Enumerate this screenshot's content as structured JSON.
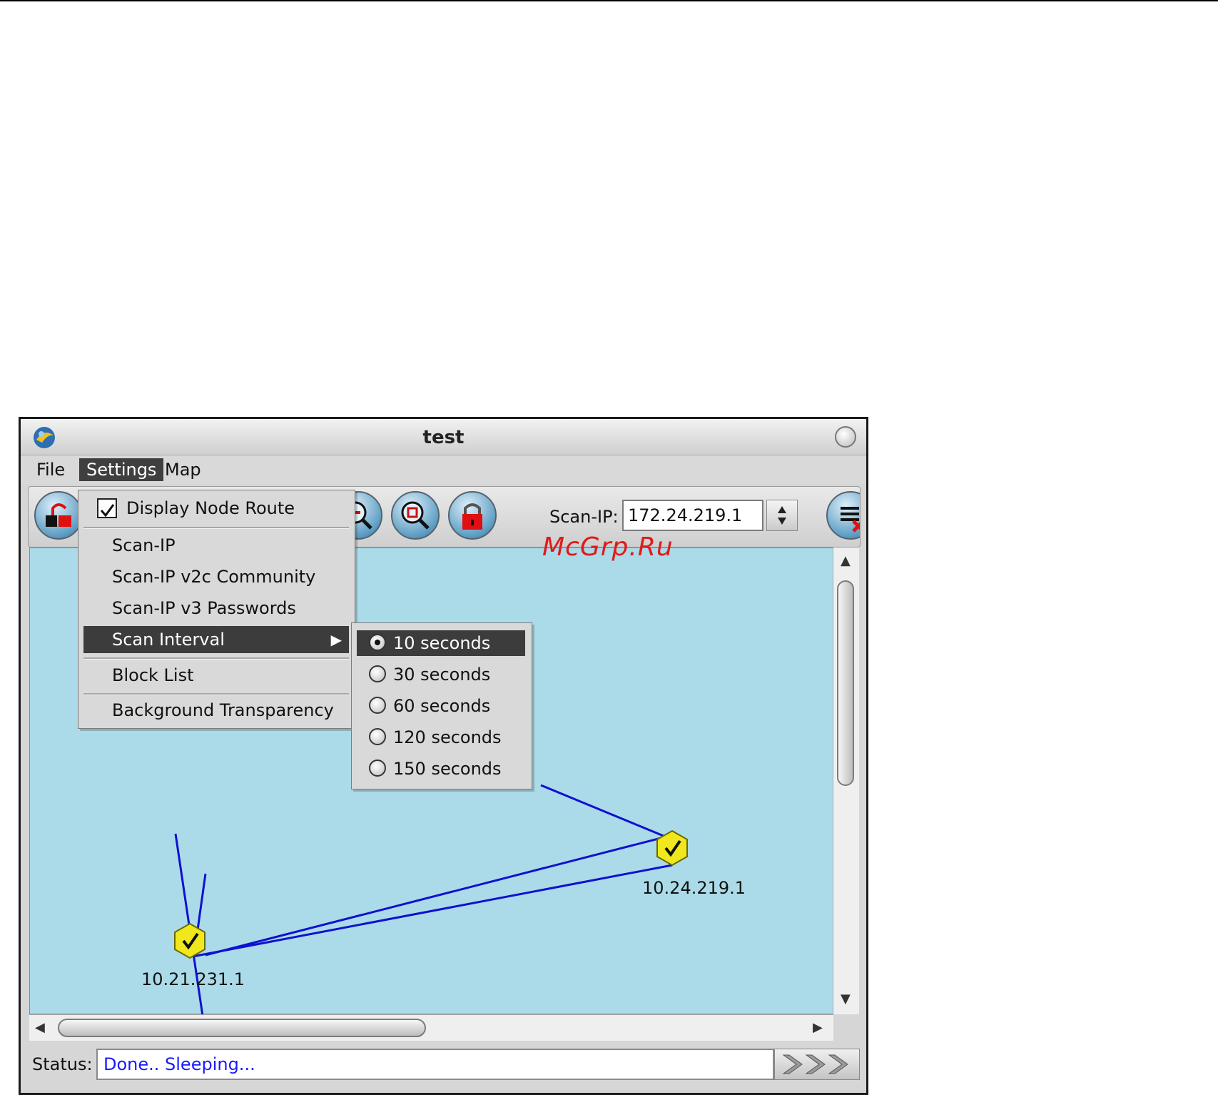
{
  "window": {
    "title": "test"
  },
  "menubar": {
    "file": "File",
    "settings": "Settings",
    "map": "Map"
  },
  "toolbar": {
    "buttons": [
      "unlock-icon",
      "zoom-out-icon",
      "zoom-fit-icon",
      "lock-icon",
      "list-delete-icon"
    ],
    "scan_ip_label": "Scan-IP:",
    "scan_ip_value": "172.24.219.1"
  },
  "settings_menu": {
    "display_node_route": "Display Node Route",
    "display_node_route_checked": true,
    "scan_ip": "Scan-IP",
    "scan_ip_v2c": "Scan-IP v2c Community",
    "scan_ip_v3": "Scan-IP v3 Passwords",
    "scan_interval": "Scan Interval",
    "block_list": "Block List",
    "background_transparency": "Background Transparency"
  },
  "scan_interval_menu": {
    "options": [
      "10 seconds",
      "30 seconds",
      "60 seconds",
      "120 seconds",
      "150 seconds"
    ],
    "selected": "10 seconds"
  },
  "map": {
    "nodes": [
      {
        "label": "10.24.219.1",
        "status": "ok"
      },
      {
        "label": "10.21.231.1",
        "status": "ok"
      }
    ],
    "link_color": "#1010d0",
    "background_color": "#abdbe9",
    "node_color": "#f0e81c"
  },
  "status": {
    "label": "Status:",
    "text": "Done.. Sleeping..."
  },
  "watermark": "McGrp.Ru"
}
